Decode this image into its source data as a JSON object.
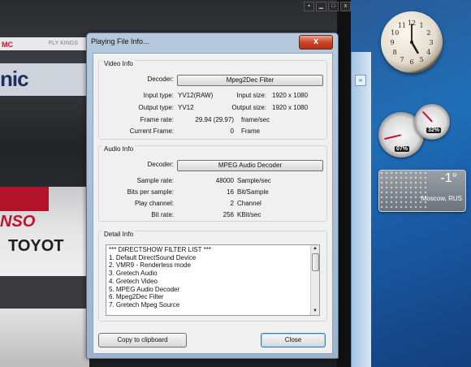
{
  "dialog": {
    "title": "Playing File Info...",
    "close_glyph": "x",
    "video": {
      "header": "Video Info",
      "decoder_label": "Decoder:",
      "decoder": "Mpeg2Dec Filter",
      "input_type_label": "Input type:",
      "input_type": "YV12(RAW)",
      "input_size_label": "Input size:",
      "input_size": "1920 x 1080",
      "output_type_label": "Output type:",
      "output_type": "YV12",
      "output_size_label": "Output size:",
      "output_size": "1920 x 1080",
      "frame_rate_label": "Frame rate:",
      "frame_rate": "29.94 (29.97)",
      "frame_rate_unit": "frame/sec",
      "current_frame_label": "Current Frame:",
      "current_frame": "0",
      "current_frame_unit": "Frame"
    },
    "audio": {
      "header": "Audio Info",
      "decoder_label": "Decoder:",
      "decoder": "MPEG Audio Decoder",
      "sample_rate_label": "Sample rate:",
      "sample_rate": "48000",
      "sample_rate_unit": "Sample/sec",
      "bits_label": "Bits per sample:",
      "bits": "16",
      "bits_unit": "Bit/Sample",
      "channel_label": "Play channel:",
      "channel": "2",
      "channel_unit": "Channel",
      "bitrate_label": "Bit rate:",
      "bitrate": "256",
      "bitrate_unit": "KBit/sec"
    },
    "detail": {
      "header": "Detail Info",
      "items": [
        "*** DIRECTSHOW FILTER LIST ***",
        "1. Default DirectSound Device",
        "2. VMR9 - Renderless mode",
        "3. Gretech Audio",
        "4. Gretech Video",
        "5. MPEG Audio Decoder",
        "6. Mpeg2Dec Filter",
        "7. Gretech Mpeg Source"
      ]
    },
    "copy_button": "Copy to clipboard",
    "close_button": "Close"
  },
  "player": {
    "controls": [
      "▪",
      "▁",
      "□",
      "x"
    ],
    "background_text": {
      "banner_left": "MC",
      "banner_right": "FLY KINGS",
      "sign": "nic",
      "car_brand_1": "NSO",
      "car_brand_2": "TOYOT"
    }
  },
  "gadgets": {
    "clock": {
      "hour": 5,
      "minute": 0
    },
    "cpu_meter": {
      "label": "07%",
      "level": 0.07
    },
    "memory_meter": {
      "label": "32%",
      "level": 0.32
    },
    "weather": {
      "temperature": "-1°",
      "city": "Moscow, RUS"
    }
  },
  "colors": {
    "dialog_frame": "#9cb4ce",
    "close_red": "#c9442a",
    "default_button_border": "#3c7fb1",
    "desktop_blue": "#1f6fb8"
  }
}
